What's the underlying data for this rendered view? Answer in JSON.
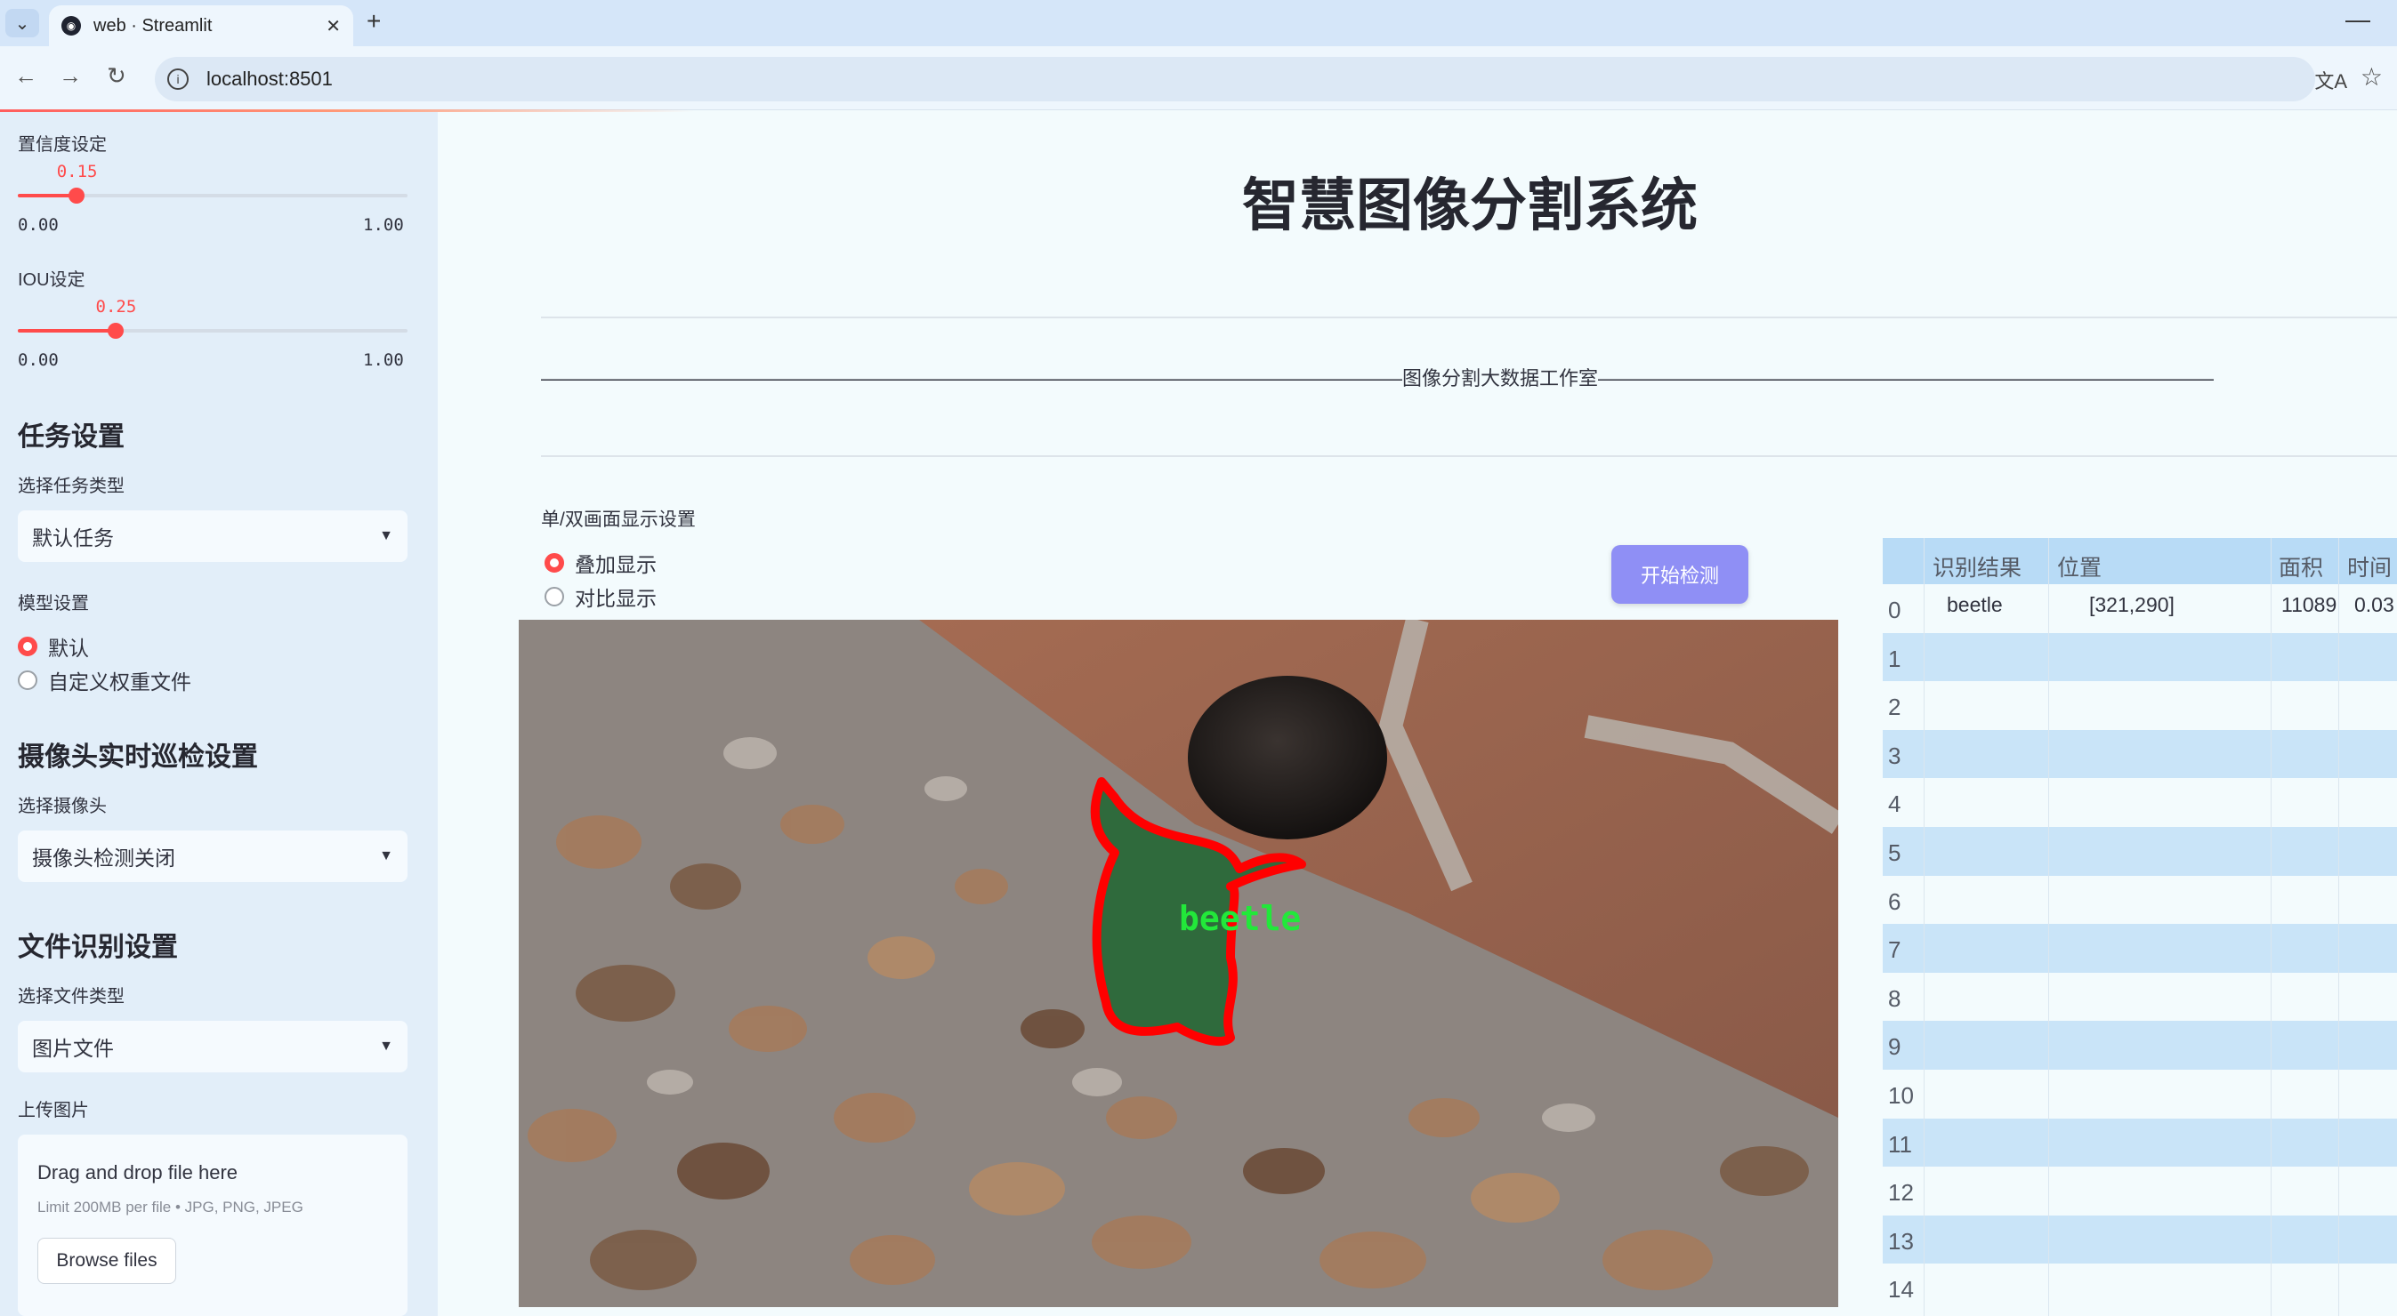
{
  "browser": {
    "tab_title": "web · Streamlit",
    "url": "localhost:8501"
  },
  "sidebar": {
    "confidence": {
      "label": "置信度设定",
      "value": "0.15",
      "fraction": 0.15,
      "min": "0.00",
      "max": "1.00"
    },
    "iou": {
      "label": "IOU设定",
      "value": "0.25",
      "fraction": 0.25,
      "min": "0.00",
      "max": "1.00"
    },
    "task_section": "任务设置",
    "task_type_label": "选择任务类型",
    "task_type_value": "默认任务",
    "model_label": "模型设置",
    "model_options": [
      "默认",
      "自定义权重文件"
    ],
    "model_selected": 0,
    "camera_section": "摄像头实时巡检设置",
    "camera_label": "选择摄像头",
    "camera_value": "摄像头检测关闭",
    "file_section": "文件识别设置",
    "file_type_label": "选择文件类型",
    "file_type_value": "图片文件",
    "upload_label": "上传图片",
    "upload_title": "Drag and drop file here",
    "upload_limit": "Limit 200MB per file • JPG, PNG, JPEG",
    "browse_label": "Browse files"
  },
  "main": {
    "title": "智慧图像分割系统",
    "studio_line": "————————————————————————————————————————————图像分割大数据工作室———————————————————————————————————————————",
    "display_label": "单/双画面显示设置",
    "display_options": [
      "叠加显示",
      "对比显示"
    ],
    "display_selected": 0,
    "start_button": "开始检测",
    "mask_label": "beetle"
  },
  "table": {
    "columns": [
      "识别结果",
      "位置",
      "面积",
      "时间"
    ],
    "rows": [
      {
        "index": "0",
        "result": "beetle",
        "position": "[321,290]",
        "area": "11089",
        "time": "0.03"
      },
      {
        "index": "1"
      },
      {
        "index": "2"
      },
      {
        "index": "3"
      },
      {
        "index": "4"
      },
      {
        "index": "5"
      },
      {
        "index": "6"
      },
      {
        "index": "7"
      },
      {
        "index": "8"
      },
      {
        "index": "9"
      },
      {
        "index": "10"
      },
      {
        "index": "11"
      },
      {
        "index": "12"
      },
      {
        "index": "13"
      },
      {
        "index": "14"
      }
    ]
  },
  "colors": {
    "accent": "#ff4b4b",
    "button": "#8f8ff5",
    "table_stripe": "#c9e4f8",
    "mask_outline": "#ff0000",
    "mask_label": "#22e83a"
  }
}
